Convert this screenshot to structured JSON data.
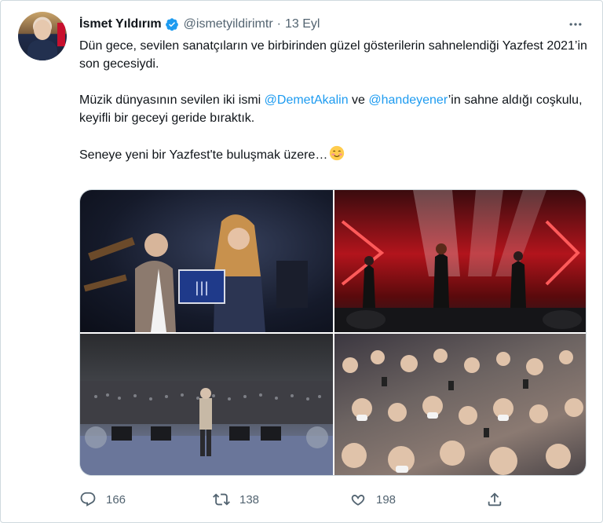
{
  "author": {
    "name": "İsmet Yıldırım",
    "handle": "@ismetyildirimtr",
    "separator": "·",
    "date": "13 Eyl",
    "verified_color": "#1d9bf0"
  },
  "tweet": {
    "para1": "Dün gece, sevilen sanatçıların ve birbirinden güzel gösterilerin sahnelendiği Yazfest 2021’in son gecesiydi.",
    "para2_prefix": "Müzik dünyasının sevilen iki ismi ",
    "mention1": "@DemetAkalin",
    "para2_mid": " ve ",
    "mention2": "@handeyener",
    "para2_suffix": "’in sahne aldığı coşkulu, keyifli bir geceyi geride bıraktık.",
    "para3": "Seneye yeni bir Yazfest'te buluşmak üzere…",
    "emoji": "smiling-face-icon"
  },
  "media": {
    "photos": [
      "award-ceremony-photo",
      "stage-performance-photo",
      "stage-audience-view-photo",
      "crowd-photo"
    ]
  },
  "actions": {
    "replies": "166",
    "retweets": "138",
    "likes": "198"
  },
  "colors": {
    "text": "#0f1419",
    "secondary": "#536471",
    "accent": "#1d9bf0",
    "border": "#cfd9de"
  }
}
